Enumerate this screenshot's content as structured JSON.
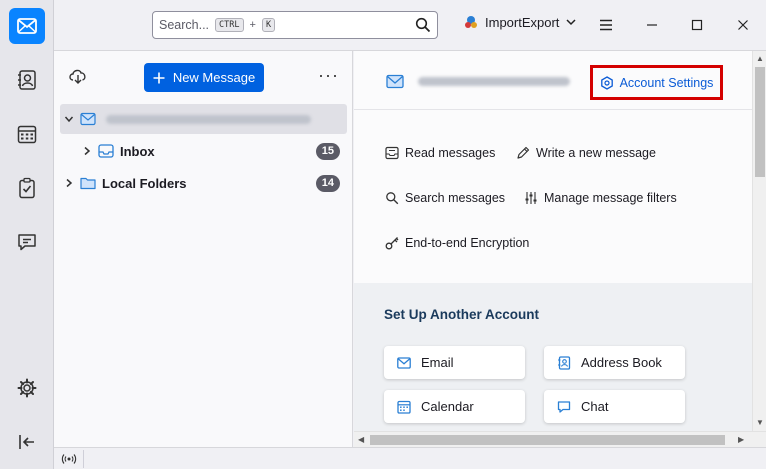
{
  "search": {
    "placeholder": "Search...",
    "key1": "CTRL",
    "plus": "+",
    "key2": "K"
  },
  "addon": {
    "label": "ImportExport"
  },
  "folder_pane": {
    "new_message": "New Message",
    "more": "···",
    "folders": [
      {
        "label": "Inbox",
        "count": "15"
      },
      {
        "label": "Local Folders",
        "count": "14"
      }
    ]
  },
  "central": {
    "account_settings": "Account Settings",
    "actions": {
      "read": "Read messages",
      "write": "Write a new message",
      "search": "Search messages",
      "filters": "Manage message filters",
      "e2e": "End-to-end Encryption"
    },
    "setup_title": "Set Up Another Account",
    "setup": {
      "email": "Email",
      "address_book": "Address Book",
      "calendar": "Calendar",
      "chat": "Chat"
    }
  },
  "colors": {
    "accent": "#0061e0",
    "highlight": "#d40000",
    "link": "#0a5bd6"
  }
}
